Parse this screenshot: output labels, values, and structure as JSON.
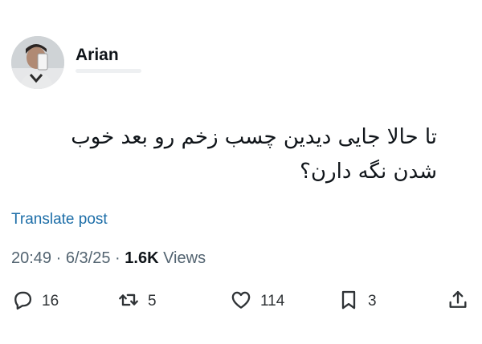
{
  "author": {
    "name": "Arian"
  },
  "tweet": {
    "text": "تا حالا جایی دیدین چسب زخم رو بعد خوب شدن نگه دارن؟",
    "translate_label": "Translate post",
    "time": "20:49",
    "separator": "·",
    "date": "6/3/25",
    "views_count": "1.6K",
    "views_label": "Views"
  },
  "actions": {
    "reply": {
      "icon": "reply-icon",
      "count": "16"
    },
    "retweet": {
      "icon": "retweet-icon",
      "count": "5"
    },
    "like": {
      "icon": "heart-icon",
      "count": "114"
    },
    "bookmark": {
      "icon": "bookmark-icon",
      "count": "3"
    },
    "share": {
      "icon": "share-icon"
    }
  },
  "colors": {
    "text": "#0f1419",
    "secondary": "#536471",
    "link": "#1d6ea8",
    "icon": "#2f3336"
  }
}
